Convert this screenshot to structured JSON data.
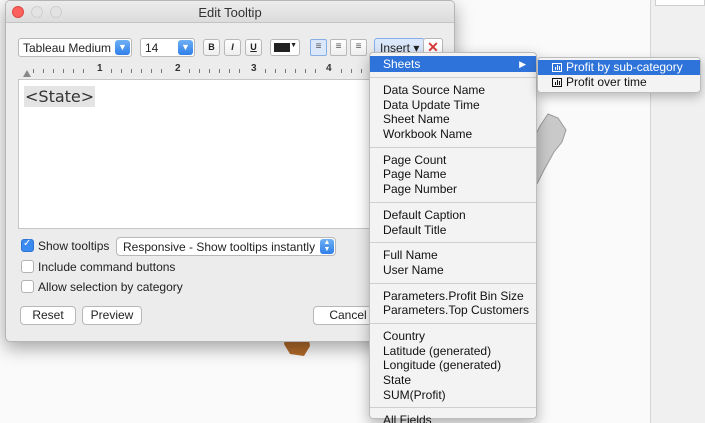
{
  "dialog": {
    "title": "Edit Tooltip"
  },
  "toolbar": {
    "font_family": "Tableau Medium",
    "font_size": "14",
    "bold": "B",
    "italic": "I",
    "underline": "U",
    "text_color": "#222222",
    "insert_label": "Insert ▾",
    "clear_label": "✕"
  },
  "ruler": {
    "marks": [
      "1",
      "2",
      "3",
      "4"
    ]
  },
  "editor": {
    "content": "<State>"
  },
  "options": {
    "show_tooltips_label": "Show tooltips",
    "show_tooltips_checked": true,
    "tooltip_mode": "Responsive - Show tooltips instantly",
    "include_command_buttons_label": "Include command buttons",
    "allow_selection_label": "Allow selection by category"
  },
  "buttons": {
    "reset": "Reset",
    "preview": "Preview",
    "cancel": "Cancel"
  },
  "insert_menu": {
    "sheets_label": "Sheets",
    "group1": [
      "Data Source Name",
      "Data Update Time",
      "Sheet Name",
      "Workbook Name"
    ],
    "group2": [
      "Page Count",
      "Page Name",
      "Page Number"
    ],
    "group3": [
      "Default Caption",
      "Default Title"
    ],
    "group4": [
      "Full Name",
      "User Name"
    ],
    "group5": [
      "Parameters.Profit Bin Size",
      "Parameters.Top Customers"
    ],
    "group6": [
      "Country",
      "Latitude (generated)",
      "Longitude (generated)",
      "State",
      "SUM(Profit)"
    ],
    "all_fields": "All Fields"
  },
  "sheets_submenu": [
    "Profit by sub-category",
    "Profit over time"
  ],
  "colors": {
    "highlight": "#2e73d9",
    "close_red": "#fc605c",
    "select_blue": "#2f7fe8"
  }
}
